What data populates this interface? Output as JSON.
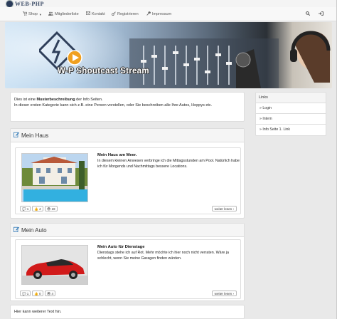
{
  "brand": {
    "logo_text": "WEB-PHP"
  },
  "nav": {
    "items": [
      {
        "icon": "cart-icon",
        "glyph": "🛒",
        "label": "Shop",
        "dropdown": true
      },
      {
        "icon": "users-icon",
        "glyph": "👥",
        "label": "Mitgliederliste"
      },
      {
        "icon": "envelope-icon",
        "glyph": "✉",
        "label": "Kontakt"
      },
      {
        "icon": "key-icon",
        "glyph": "🔑",
        "label": "Registrieren"
      },
      {
        "icon": "wrench-icon",
        "glyph": "🔧",
        "label": "Impressum"
      }
    ],
    "right_icons": [
      "search-icon",
      "sign-in-icon"
    ]
  },
  "banner": {
    "title": "W-P Shoutcast Stream"
  },
  "intro": {
    "line1_pre": "Dies ist eine ",
    "line1_bold": "Musterbeschreibung",
    "line1_post": " der Info Seiten.",
    "line2": "In dieser ersten Kategorie kann sich z.B. eine Person vorstellen, oder Sie beschreiben alle Ihre Autos, Hoppys etc."
  },
  "sidebar": {
    "title": "Links",
    "links": [
      "» Login",
      "» Intern",
      "» Info Seite 1. Link"
    ]
  },
  "panels": [
    {
      "title": "Mein Haus",
      "article_title": "Mein Haus am Meer.",
      "article_text": "In diesem kleinen Anwesen verbringe ich die Mittagsstunden am Pool. Natürlich habe ich für Morgends und Nachmittags bessere Locations.",
      "comments": "1",
      "likes": "4",
      "views": "19",
      "more_label": "weiter lesen"
    },
    {
      "title": "Mein Auto",
      "article_title": "Mein Auto für Dienstage",
      "article_text": "Dienstags stehe ich auf Rot. Mehr möchte ich hier noch nicht verraten. Wäre ja schlecht, wenn Sie meine Garagen finden würden.",
      "comments": "1",
      "likes": "0",
      "views": "4",
      "more_label": "weiter lesen"
    }
  ],
  "footer": {
    "text": "Hier kann weiterer Text hin."
  },
  "colors": {
    "accent": "#337ab7",
    "navbar": "#f8f8f8",
    "page_bg": "#e9e9e9"
  }
}
